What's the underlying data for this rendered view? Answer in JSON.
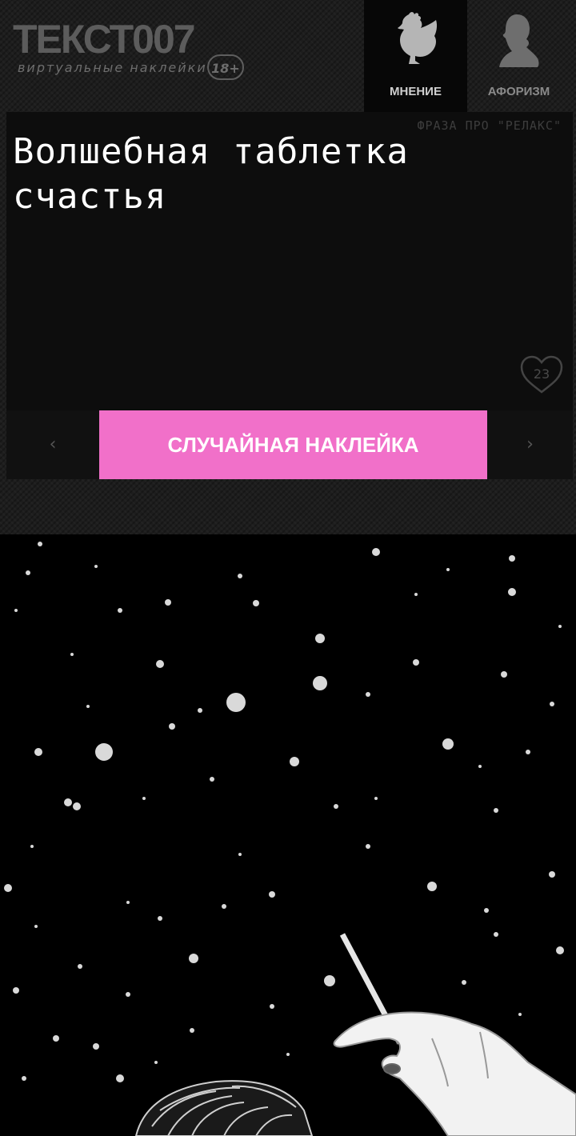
{
  "header": {
    "logo_title": "ТЕКСТ007",
    "logo_subtitle": "виртуальные наклейки",
    "age_badge": "18+",
    "tabs": [
      {
        "label": "МНЕНИЕ",
        "icon": "chicken-icon",
        "active": true
      },
      {
        "label": "АФОРИЗМ",
        "icon": "portrait-silhouette-icon",
        "active": false
      }
    ]
  },
  "card": {
    "category": "ФРАЗА ПРО \"РЕЛАКС\"",
    "phrase": "Волшебная таблетка счастья",
    "likes": "23"
  },
  "controls": {
    "prev_icon": "‹",
    "next_icon": "›",
    "random_label": "СЛУЧАЙНАЯ НАКЛЕЙКА"
  },
  "colors": {
    "accent": "#f170c9",
    "background": "#1d1d1d",
    "card": "#0d0d0d"
  }
}
